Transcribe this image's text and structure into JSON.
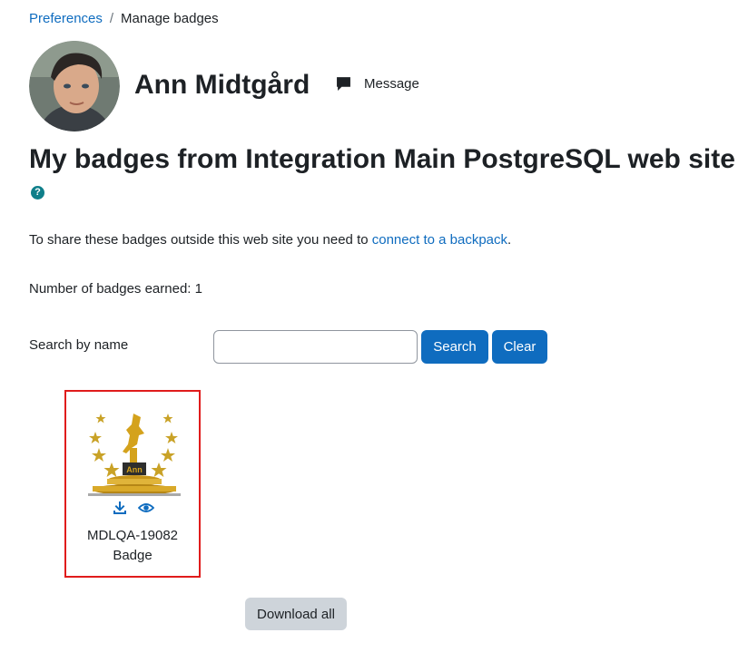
{
  "breadcrumb": {
    "items": [
      {
        "label": "Preferences"
      },
      {
        "label": "Manage badges"
      }
    ],
    "separator": "/"
  },
  "profile": {
    "name": "Ann Midtgård",
    "message_label": "Message",
    "avatar_icon": "user-photo"
  },
  "page": {
    "heading": "My badges from Integration Main PostgreSQL web site",
    "help_icon": "?",
    "share_prefix": "To share these badges outside this web site you need to ",
    "share_link": "connect to a backpack",
    "share_suffix": ".",
    "count_text": "Number of badges earned: 1"
  },
  "search": {
    "label": "Search by name",
    "value": "",
    "placeholder": "",
    "search_button": "Search",
    "clear_button": "Clear"
  },
  "badges": [
    {
      "name_line1": "MDLQA-19082",
      "name_line2": "Badge",
      "image_text": "Ann",
      "actions": [
        "download-icon",
        "eye-icon"
      ]
    }
  ],
  "download_all": "Download all",
  "colors": {
    "link": "#0f6cbf",
    "primary_button": "#0f6cbf",
    "secondary_button": "#ced4da",
    "highlight_border": "#e01c1c",
    "help_icon": "#0f7f8a"
  }
}
